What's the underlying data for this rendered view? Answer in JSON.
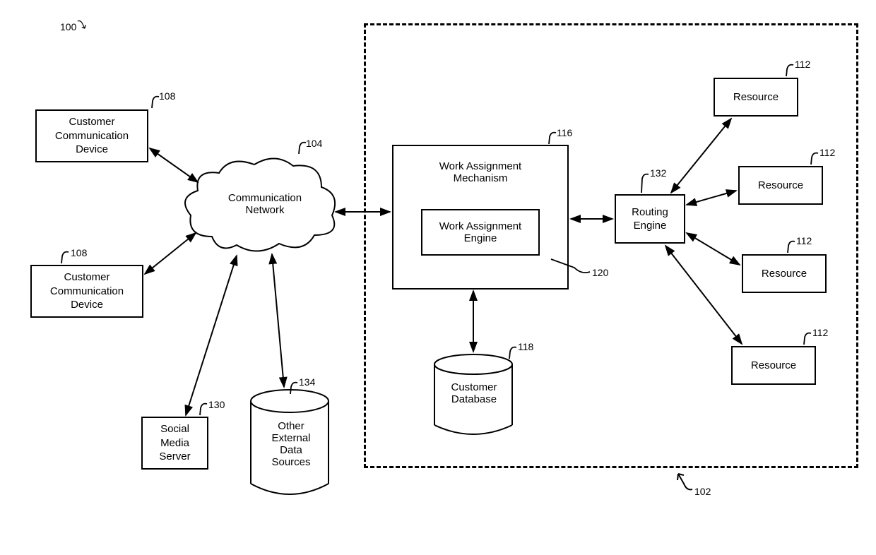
{
  "refs": {
    "overall": "100",
    "system": "102",
    "network": "104",
    "device1": "108",
    "device2": "108",
    "resource1": "112",
    "resource2": "112",
    "resource3": "112",
    "resource4": "112",
    "wam": "116",
    "db": "118",
    "wae": "120",
    "social": "130",
    "routing": "132",
    "external": "134"
  },
  "labels": {
    "device": "Customer\nCommunication\nDevice",
    "network": "Communication\nNetwork",
    "social": "Social\nMedia\nServer",
    "external": "Other\nExternal\nData\nSources",
    "wam": "Work Assignment\nMechanism",
    "wae": "Work Assignment\nEngine",
    "db": "Customer\nDatabase",
    "routing": "Routing\nEngine",
    "resource": "Resource"
  }
}
